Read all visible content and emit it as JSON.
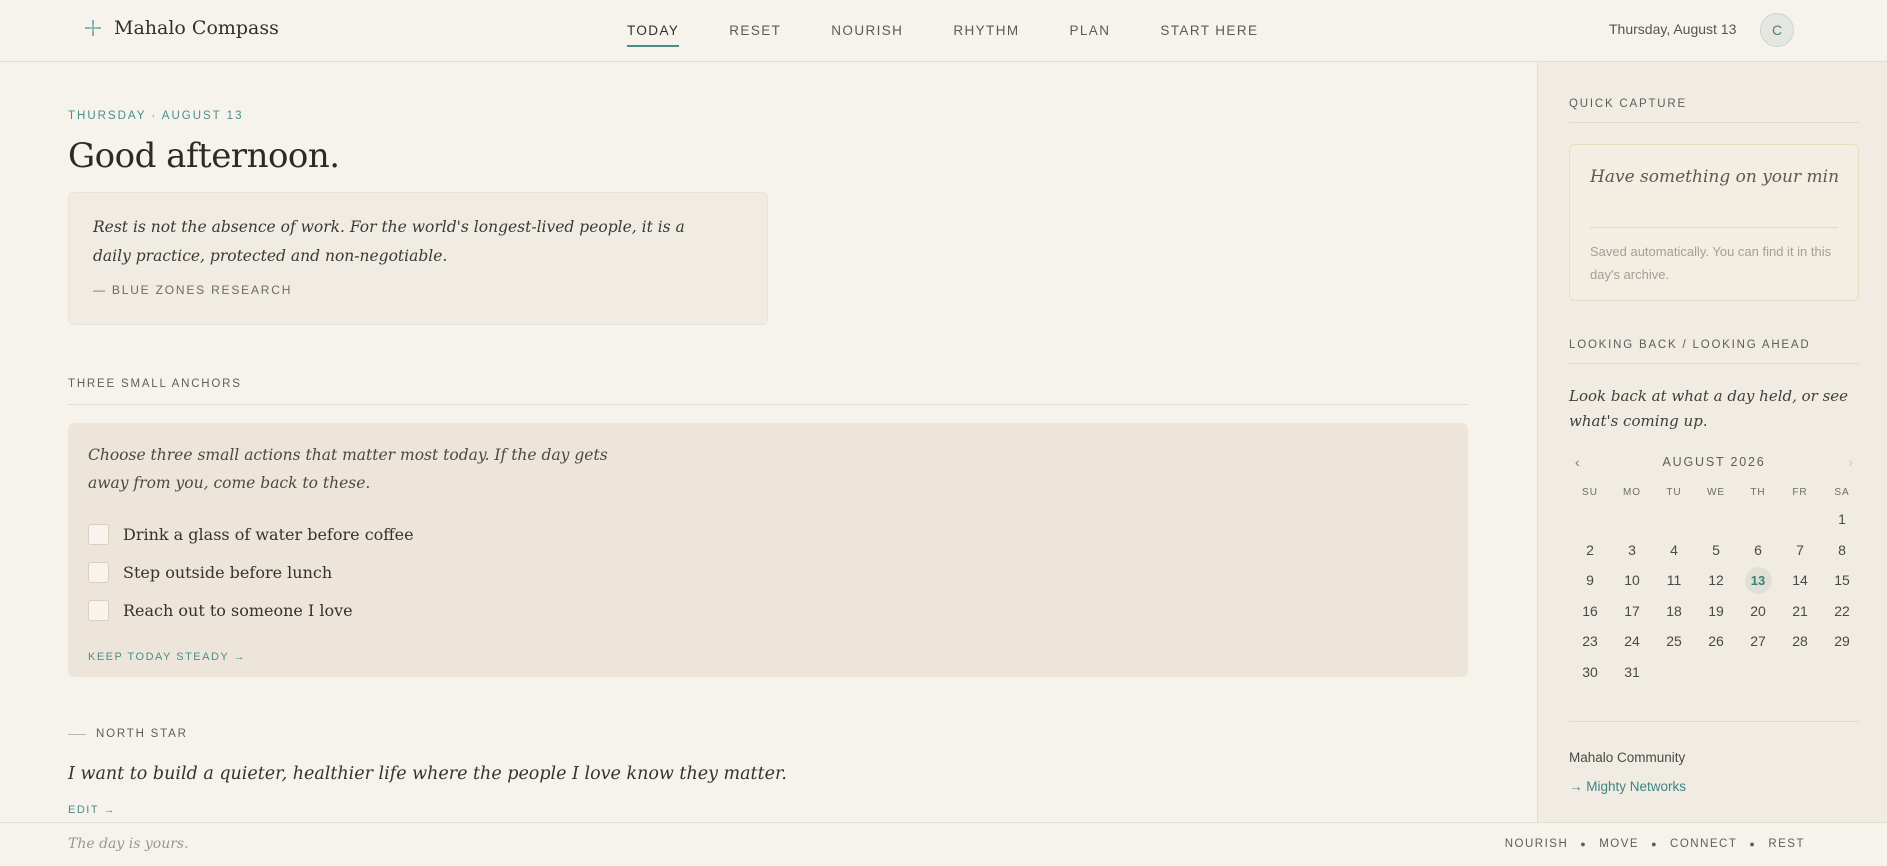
{
  "header": {
    "brand": "Mahalo Compass",
    "nav": [
      "TODAY",
      "RESET",
      "NOURISH",
      "RHYTHM",
      "PLAN",
      "START HERE"
    ],
    "active_nav": "TODAY",
    "date": "Thursday, August 13",
    "avatar_initial": "C"
  },
  "main": {
    "eyebrow": "THURSDAY · AUGUST 13",
    "greeting": "Good afternoon.",
    "quote": {
      "text": "Rest is not the absence of work. For the world's longest-lived people, it is a daily practice, protected and non-negotiable.",
      "attribution": "— BLUE ZONES RESEARCH"
    },
    "anchors": {
      "label": "THREE SMALL ANCHORS",
      "intro": "Choose three small actions that matter most today. If the day gets away from you, come back to these.",
      "items": [
        "Drink a glass of water before coffee",
        "Step outside before lunch",
        "Reach out to someone I love"
      ],
      "link": "KEEP TODAY STEADY →"
    },
    "north_star": {
      "label": "NORTH STAR",
      "text": "I want to build a quieter, healthier life where the people I love know they matter.",
      "edit": "EDIT →"
    }
  },
  "sidebar": {
    "capture": {
      "label": "QUICK CAPTURE",
      "placeholder": "Have something on your mind? Jot it down here so you",
      "note": "Saved automatically. You can find it in this day's archive."
    },
    "look": {
      "label": "LOOKING BACK / LOOKING AHEAD",
      "text": "Look back at what a day held, or see what's coming up."
    },
    "calendar": {
      "month": "AUGUST 2026",
      "prev": "‹",
      "next": "›",
      "weekdays": [
        "SU",
        "MO",
        "TU",
        "WE",
        "TH",
        "FR",
        "SA"
      ],
      "leading_blanks": 6,
      "days": 31,
      "today": 13
    },
    "community": {
      "title": "Mahalo Community",
      "link": "→ Mighty Networks"
    }
  },
  "footer": {
    "tagline": "The day is yours.",
    "nav": [
      "NOURISH",
      "MOVE",
      "CONNECT",
      "REST"
    ]
  },
  "colors": {
    "accent": "#4a8d87",
    "background": "#f6f3ec",
    "card": "#ede5da"
  }
}
